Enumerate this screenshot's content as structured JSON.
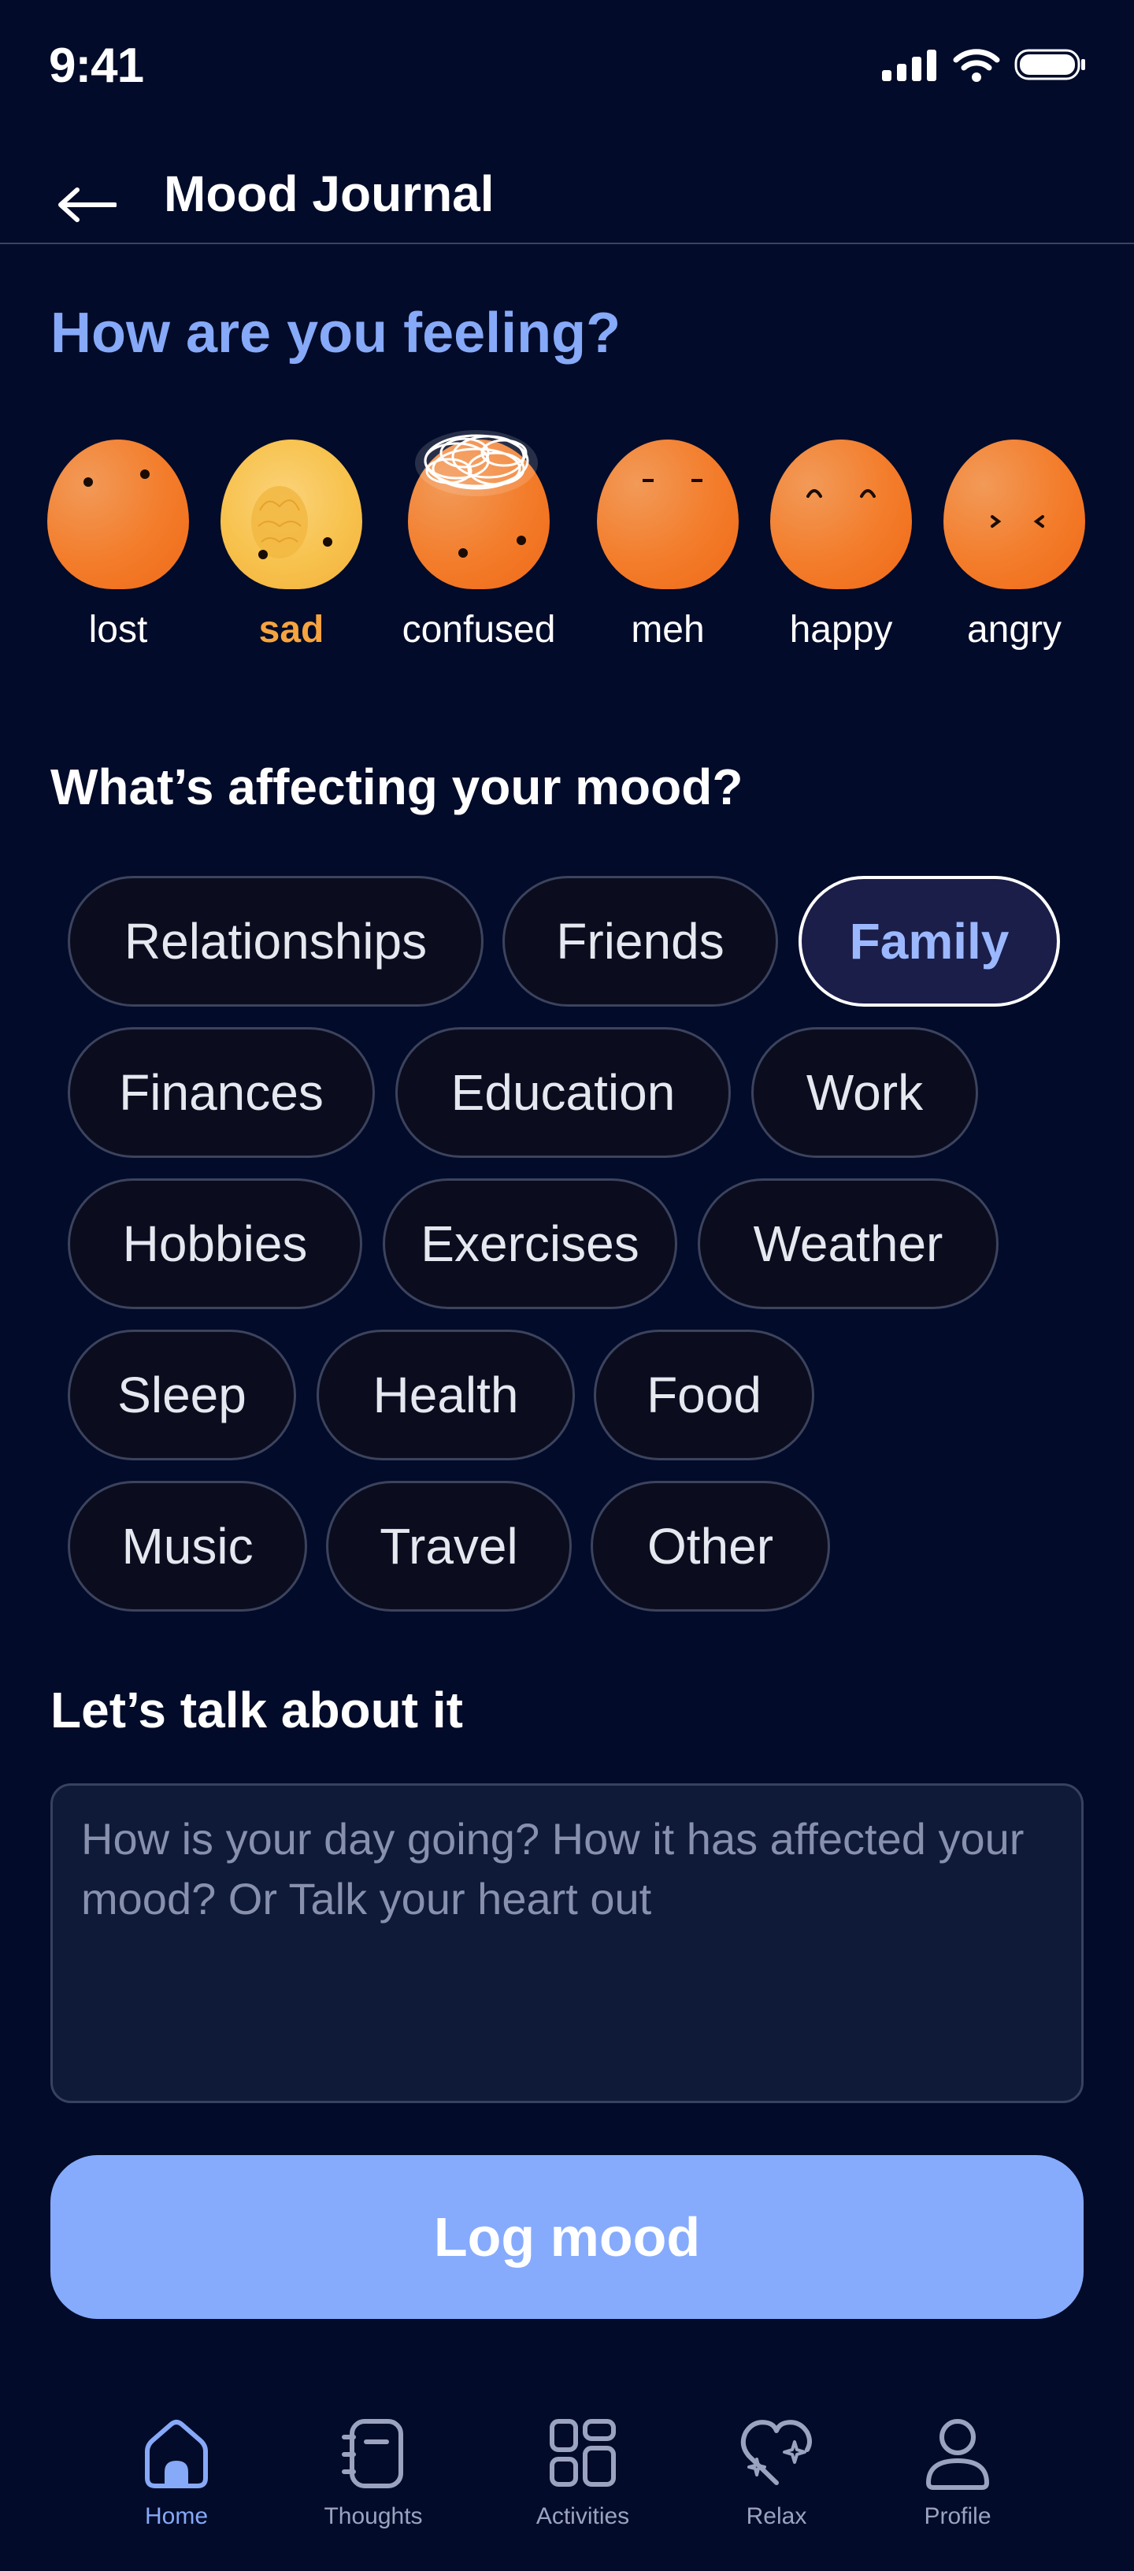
{
  "status_bar": {
    "time": "9:41"
  },
  "header": {
    "title": "Mood Journal"
  },
  "feeling": {
    "heading": "How are you feeling?",
    "moods": [
      {
        "label": "lost",
        "selected": false
      },
      {
        "label": "sad",
        "selected": true
      },
      {
        "label": "confused",
        "selected": false
      },
      {
        "label": "meh",
        "selected": false
      },
      {
        "label": "happy",
        "selected": false
      },
      {
        "label": "angry",
        "selected": false
      }
    ]
  },
  "affecting": {
    "heading": "What’s affecting your mood?",
    "chips": [
      {
        "label": "Relationships",
        "selected": false
      },
      {
        "label": "Friends",
        "selected": false
      },
      {
        "label": "Family",
        "selected": true
      },
      {
        "label": "Finances",
        "selected": false
      },
      {
        "label": "Education",
        "selected": false
      },
      {
        "label": "Work",
        "selected": false
      },
      {
        "label": "Hobbies",
        "selected": false
      },
      {
        "label": "Exercises",
        "selected": false
      },
      {
        "label": "Weather",
        "selected": false
      },
      {
        "label": "Sleep",
        "selected": false
      },
      {
        "label": "Health",
        "selected": false
      },
      {
        "label": "Food",
        "selected": false
      },
      {
        "label": "Music",
        "selected": false
      },
      {
        "label": "Travel",
        "selected": false
      },
      {
        "label": "Other",
        "selected": false
      }
    ]
  },
  "talk": {
    "heading": "Let’s talk about it",
    "placeholder": "How is your day going? How it has affected your mood? Or Talk your heart out",
    "value": ""
  },
  "log_button": {
    "label": "Log mood"
  },
  "bottom_nav": {
    "items": [
      {
        "label": "Home",
        "icon": "home-icon",
        "active": true
      },
      {
        "label": "Thoughts",
        "icon": "notebook-icon",
        "active": false
      },
      {
        "label": "Activities",
        "icon": "grid-icon",
        "active": false
      },
      {
        "label": "Relax",
        "icon": "heart-sparkle-icon",
        "active": false
      },
      {
        "label": "Profile",
        "icon": "user-icon",
        "active": false
      }
    ]
  },
  "colors": {
    "background": "#020b29",
    "accent": "#86a9f8",
    "mood_orange": "#f37c2a",
    "mood_selected_label": "#f6a43f",
    "button": "#86abfd"
  }
}
